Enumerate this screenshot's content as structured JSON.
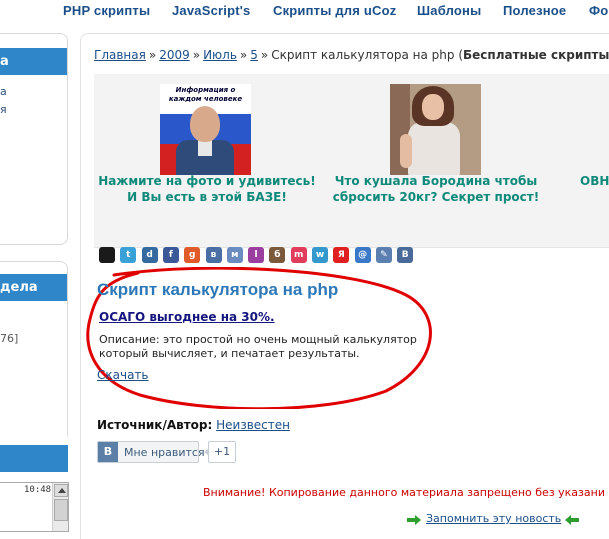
{
  "topnav": {
    "items": [
      "PHP скрипты",
      "JavaScript's",
      "Скрипты для uCoz",
      "Шаблоны",
      "Полезное",
      "Фо"
    ]
  },
  "sidebar": {
    "block1": {
      "head": "а",
      "lines": [
        "а",
        "я"
      ]
    },
    "block2": {
      "head": "дела",
      "lines": [
        "76]"
      ]
    },
    "chat": {
      "time": "10:48"
    }
  },
  "breadcrumb": {
    "items": [
      "Главная",
      "2009",
      "Июль",
      "5"
    ],
    "separator": "»",
    "current": "Скрипт калькулятора на php",
    "suffix_open": "(",
    "suffix_bold": "Бесплатные скрипты php"
  },
  "ads": [
    {
      "image_title": "Информация о каждом человеке",
      "caption": "Нажмите на фото и удивитесь! И Вы есть в этой БАЗЕ!"
    },
    {
      "caption": "Что кушала Бородина чтобы сбросить 20кг? Секрет прост!"
    },
    {
      "caption": "ОВНЬ"
    }
  ],
  "social": {
    "icons": [
      "delicious-icon",
      "twitter-icon",
      "digg-icon",
      "facebook-icon",
      "google-icon",
      "vkontakte-icon",
      "moimir-icon",
      "liveinternet-icon",
      "bobrdobr-icon",
      "memori-icon",
      "mister-wong-icon",
      "yandex-icon",
      "mail-icon",
      "livejournal-icon",
      "vk-icon"
    ],
    "colors": [
      "#1a1a1a",
      "#3aa0d8",
      "#356aa0",
      "#3b5998",
      "#e05a2a",
      "#4a6fa5",
      "#6a8cc0",
      "#9a3fa0",
      "#7a5a3a",
      "#e23c5c",
      "#3399cc",
      "#e02020",
      "#3a78c8",
      "#5a7fb0",
      "#4a6a9a"
    ],
    "glyphs": [
      "",
      "t",
      "d",
      "f",
      "g",
      "в",
      "м",
      "l",
      "б",
      "m",
      "w",
      "Я",
      "@",
      "✎",
      "B"
    ]
  },
  "article": {
    "title": "Скрипт калькулятора на php",
    "promo_link": "ОСАГО выгоднее на 30%.",
    "description": "Описание: это простой но очень мощный калькулятор который вычисляет, и печатает результаты.",
    "download": "Скачать"
  },
  "source": {
    "label": "Источник/Автор:",
    "value": "Неизвестен"
  },
  "like": {
    "badge": "B",
    "label": "Мне нравится",
    "count": "+1"
  },
  "warning": "Внимание! Копирование данного материала запрещено без указани",
  "remember": "Запомнить эту новость",
  "colors": {
    "nav": "#1b4f8a",
    "sidebar_head": "#2f86c8",
    "ad_caption": "#0f8a7a",
    "title": "#2d78b8",
    "warning": "#cc0000",
    "oval": "#e00000"
  }
}
